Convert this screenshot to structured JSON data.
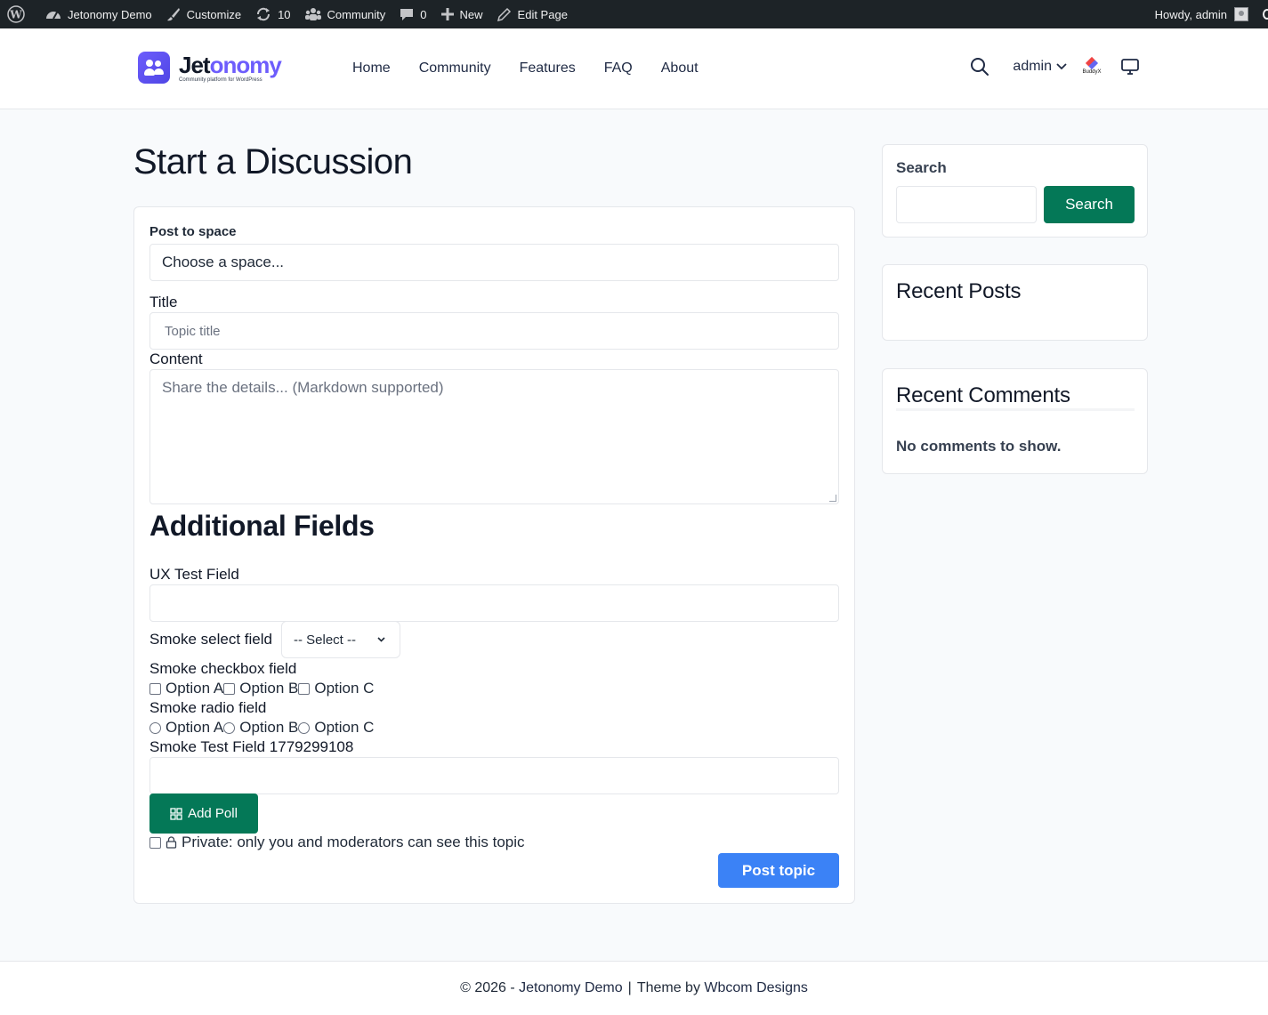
{
  "admin_bar": {
    "site_name": "Jetonomy Demo",
    "customize": "Customize",
    "updates_count": "10",
    "community": "Community",
    "comments_count": "0",
    "new": "New",
    "edit_page": "Edit Page",
    "howdy": "Howdy, admin"
  },
  "header": {
    "logo_name_part1": "Jet",
    "logo_name_part2": "onomy",
    "logo_tagline": "Community platform for WordPress",
    "nav": [
      "Home",
      "Community",
      "Features",
      "FAQ",
      "About"
    ],
    "user_menu": "admin",
    "buddyx_label": "BuddyX"
  },
  "main": {
    "page_title": "Start a Discussion",
    "form": {
      "space_label": "Post to space",
      "space_value": "Choose a space...",
      "title_label": "Title",
      "title_placeholder": "Topic title",
      "content_label": "Content",
      "content_placeholder": "Share the details... (Markdown supported)",
      "additional_heading": "Additional Fields",
      "ux_field_label": "UX Test Field",
      "smoke_select_label": "Smoke select field",
      "smoke_select_value": "-- Select --",
      "smoke_checkbox_label": "Smoke checkbox field",
      "checkbox_options": [
        "Option A",
        "Option B",
        "Option C"
      ],
      "smoke_radio_label": "Smoke radio field",
      "radio_options": [
        "Option A",
        "Option B",
        "Option C"
      ],
      "smoke_test_label": "Smoke Test Field 1779299108",
      "add_poll": "Add Poll",
      "private_label": "Private: only you and moderators can see this topic",
      "post_button": "Post topic"
    }
  },
  "sidebar": {
    "search_title": "Search",
    "search_button": "Search",
    "recent_posts_title": "Recent Posts",
    "recent_comments_title": "Recent Comments",
    "no_comments": "No comments to show."
  },
  "footer": {
    "copyright": "© 2026 -",
    "site_link": "Jetonomy Demo",
    "separator": "|",
    "theme_by": "Theme by",
    "theme_link": "Wbcom Designs"
  },
  "colors": {
    "admin_bar_bg": "#1d2327",
    "primary_green": "#047857",
    "primary_blue": "#3b82f6",
    "brand_purple": "#6d5dfc"
  }
}
